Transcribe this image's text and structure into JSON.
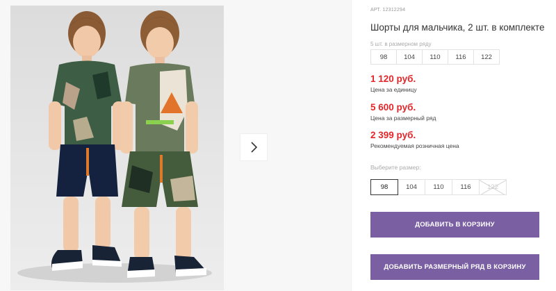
{
  "gallery": {
    "photo_alt": "",
    "next_icon": "chevron-right-icon"
  },
  "product": {
    "article": "АРТ. 12312294",
    "title": "Шорты для мальчика, 2 шт. в комплекте",
    "size_row_label": "5 шт. в размерном ряду",
    "size_row": [
      "98",
      "104",
      "110",
      "116",
      "122"
    ],
    "prices": [
      {
        "amount": "1 120 руб.",
        "note": "Цена за единицу"
      },
      {
        "amount": "5 600 руб.",
        "note": "Цена за размерный ряд"
      },
      {
        "amount": "2 399 руб.",
        "note": "Рекомендуемая розничная цена"
      }
    ],
    "choose_size_label": "Выберите размер:",
    "sizes": [
      {
        "label": "98",
        "state": "selected"
      },
      {
        "label": "104",
        "state": "available"
      },
      {
        "label": "110",
        "state": "available"
      },
      {
        "label": "116",
        "state": "available"
      },
      {
        "label": "122",
        "state": "unavailable"
      }
    ],
    "add_to_cart": "ДОБАВИТЬ В КОРЗИНУ",
    "add_size_row_to_cart": "ДОБАВИТЬ РАЗМЕРНЫЙ РЯД В КОРЗИНУ"
  },
  "colors": {
    "accent": "#7a5fa3",
    "price": "#e3262a"
  }
}
